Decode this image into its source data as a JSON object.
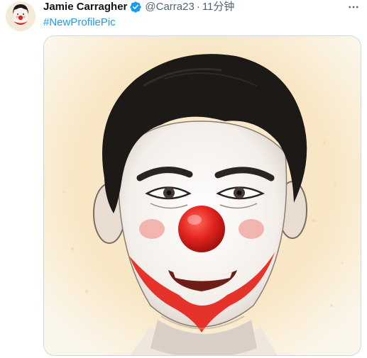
{
  "tweet": {
    "author": {
      "display_name": "Jamie Carragher",
      "handle": "@Carra23",
      "verified": true
    },
    "separator": "·",
    "timestamp": "11分钟",
    "text_hashtag": "#NewProfilePic",
    "icons": {
      "verified": "verified-badge-icon",
      "more": "more-options-icon"
    },
    "colors": {
      "link": "#1d9bf0",
      "secondary_text": "#536471",
      "verified": "#1d9bf0",
      "clown_nose": "#e32626",
      "clown_mouth": "#e5322b"
    }
  }
}
